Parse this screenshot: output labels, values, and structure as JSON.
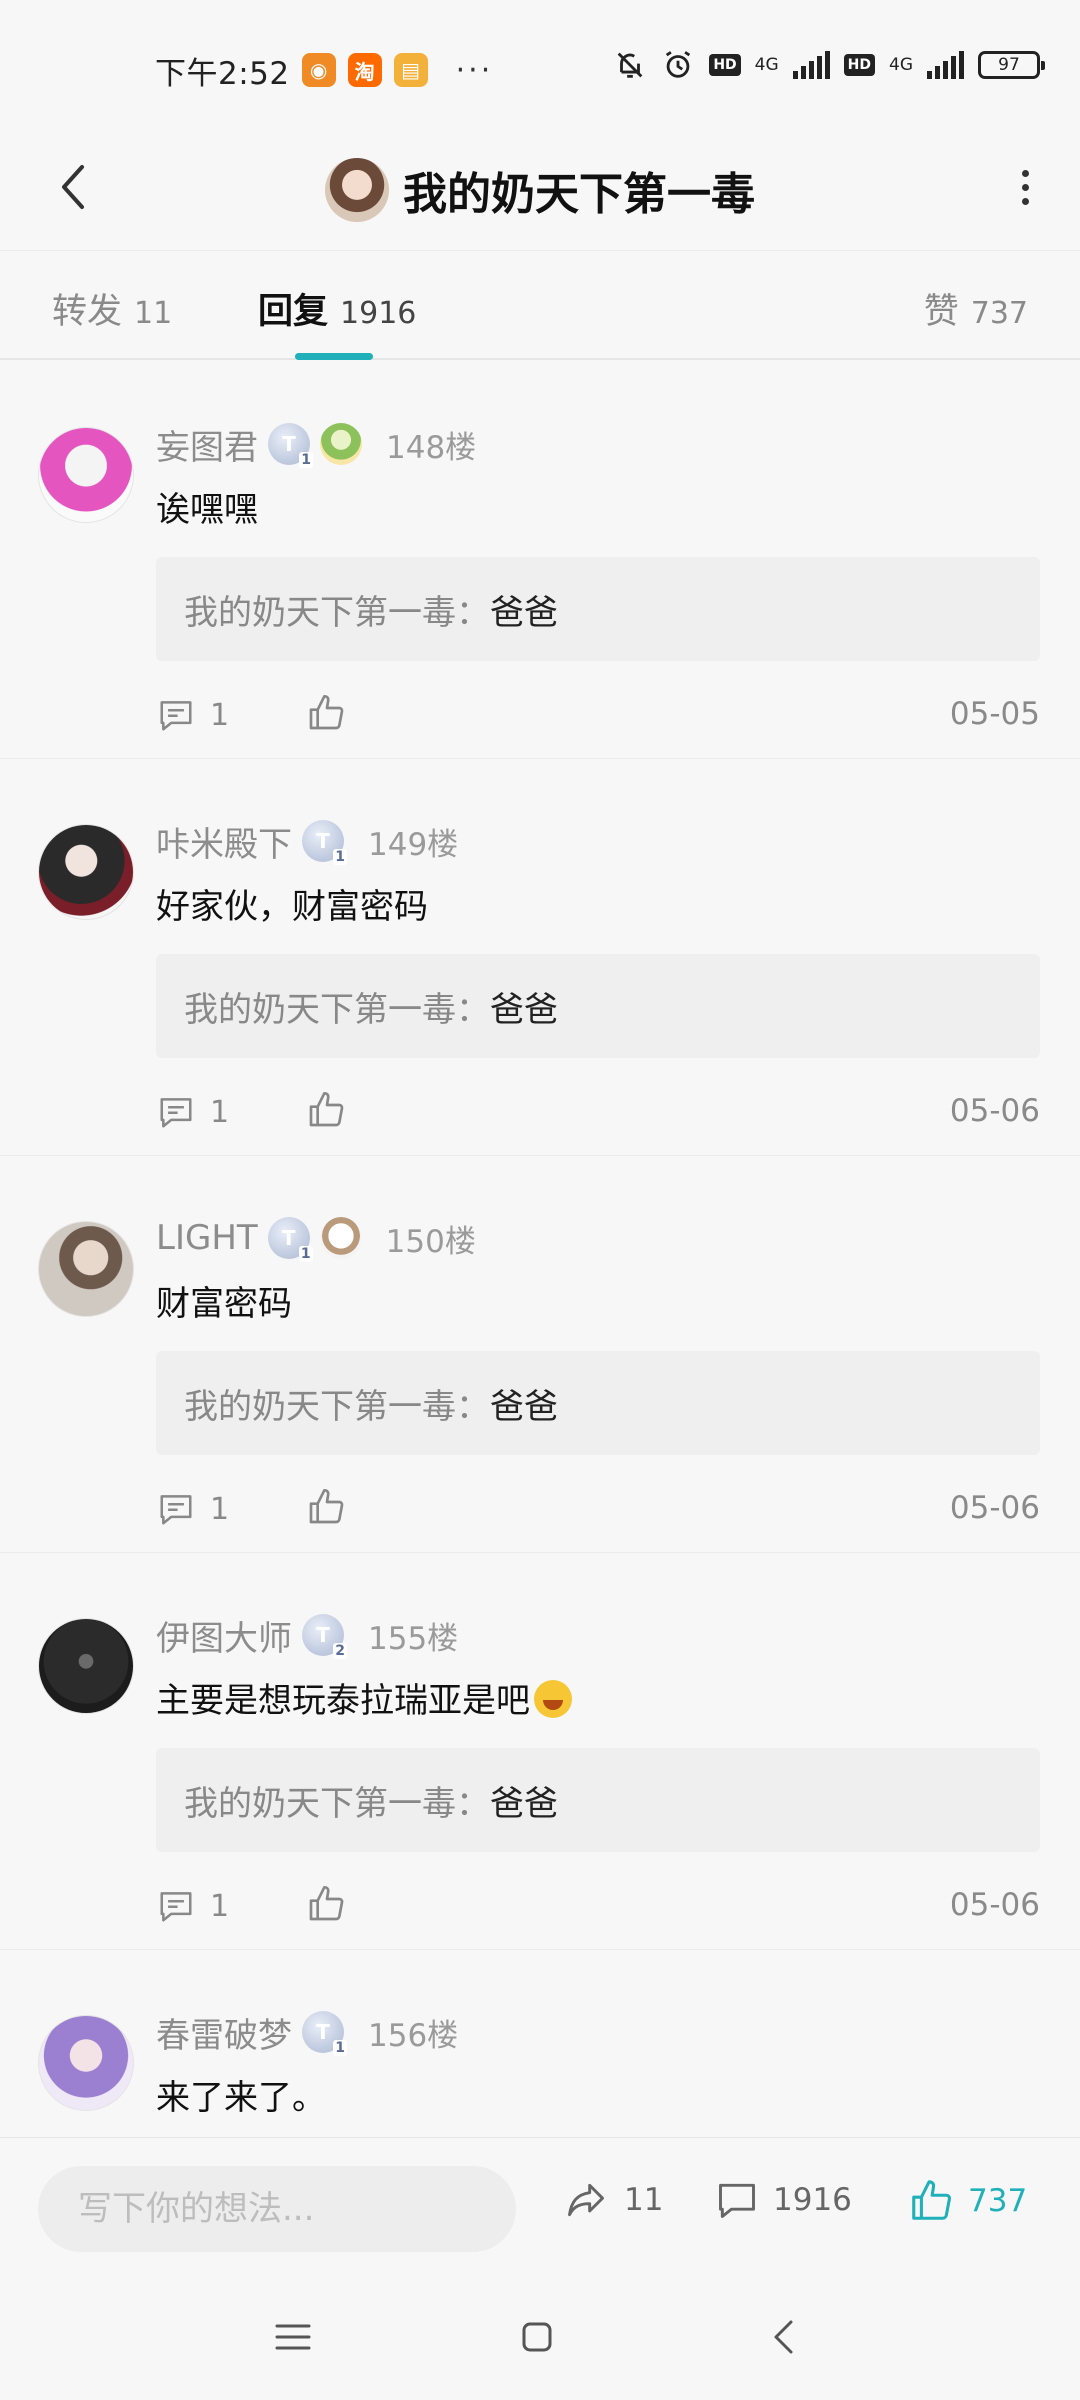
{
  "status_bar": {
    "time": "下午2:52",
    "apps": [
      "浏览器",
      "淘",
      "便签"
    ],
    "dots": "···",
    "hd": "HD",
    "network": "4G",
    "battery": "97"
  },
  "header": {
    "title": "我的奶天下第一毒"
  },
  "tabs": [
    {
      "label": "转发",
      "count": "11"
    },
    {
      "label": "回复",
      "count": "1916"
    },
    {
      "label": "赞",
      "count": "737"
    }
  ],
  "comments": [
    {
      "username": "妄图君",
      "level": "T",
      "level_sub": "1",
      "floor": "148楼",
      "text": "诶嘿嘿",
      "quote_author": "我的奶天下第一毒",
      "quote_sep": "：",
      "quote_text": "爸爸",
      "reply_count": "1",
      "date": "05-05"
    },
    {
      "username": "咔米殿下",
      "level": "T",
      "level_sub": "1",
      "floor": "149楼",
      "text": "好家伙，财富密码",
      "quote_author": "我的奶天下第一毒",
      "quote_sep": "：",
      "quote_text": "爸爸",
      "reply_count": "1",
      "date": "05-06"
    },
    {
      "username": "LIGHT",
      "level": "T",
      "level_sub": "1",
      "floor": "150楼",
      "text": "财富密码",
      "quote_author": "我的奶天下第一毒",
      "quote_sep": "：",
      "quote_text": "爸爸",
      "reply_count": "1",
      "date": "05-06"
    },
    {
      "username": "伊图大师",
      "level": "T",
      "level_sub": "2",
      "floor": "155楼",
      "text": "主要是想玩泰拉瑞亚是吧",
      "quote_author": "我的奶天下第一毒",
      "quote_sep": "：",
      "quote_text": "爸爸",
      "reply_count": "1",
      "date": "05-06"
    },
    {
      "username": "春雷破梦",
      "level": "T",
      "level_sub": "1",
      "floor": "156楼",
      "text": "来了来了。"
    }
  ],
  "bottom_bar": {
    "input_placeholder": "写下你的想法...",
    "repost_count": "11",
    "comment_count": "1916",
    "like_count": "737"
  },
  "colors": {
    "accent": "#1fb0b9",
    "background": "#f7f7f7",
    "quote_bg": "#efefef"
  },
  "icons": [
    "back-icon",
    "more-icon",
    "comment-icon",
    "thumbs-up-icon",
    "share-icon",
    "menu-icon",
    "home-icon",
    "nav-back-icon"
  ]
}
